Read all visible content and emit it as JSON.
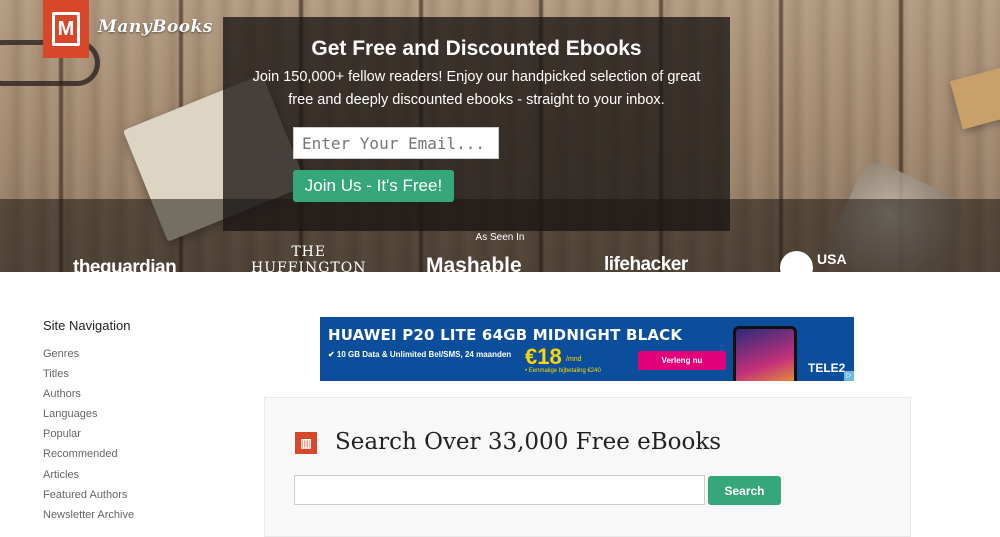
{
  "brand": {
    "logo_letter": "M",
    "name": "ManyBooks"
  },
  "signup": {
    "heading": "Get Free and Discounted Ebooks",
    "body": "Join 150,000+ fellow readers! Enjoy our handpicked selection of great free and deeply discounted ebooks - straight to your inbox.",
    "email_placeholder": "Enter Your Email...",
    "join_label": "Join Us - It's Free!"
  },
  "press": {
    "label": "As Seen In",
    "outlets": [
      "theguardian",
      "THE\nHUFFINGTON",
      "Mashable",
      "lifehacker",
      "USA"
    ]
  },
  "sidebar": {
    "title": "Site Navigation",
    "items": [
      "Genres",
      "Titles",
      "Authors",
      "Languages",
      "Popular",
      "Recommended",
      "Articles",
      "Featured Authors",
      "Newsletter Archive"
    ]
  },
  "ad": {
    "title": "HUAWEI P20 LITE 64GB MIDNIGHT BLACK",
    "description": "✔ 10 GB Data & Unlimited Bel/SMS, 24 maanden",
    "price": "€18",
    "price_unit": "/mnd",
    "fine_print": "• Eenmalige bijbetaling €240",
    "button": "Verleng nu",
    "brand": "TELE2"
  },
  "search": {
    "title": "Search Over 33,000 Free eBooks",
    "input_value": "",
    "button_label": "Search"
  },
  "colors": {
    "brand_red": "#d9472b",
    "accent_green": "#35a77a",
    "ad_blue": "#0b4f9c"
  }
}
